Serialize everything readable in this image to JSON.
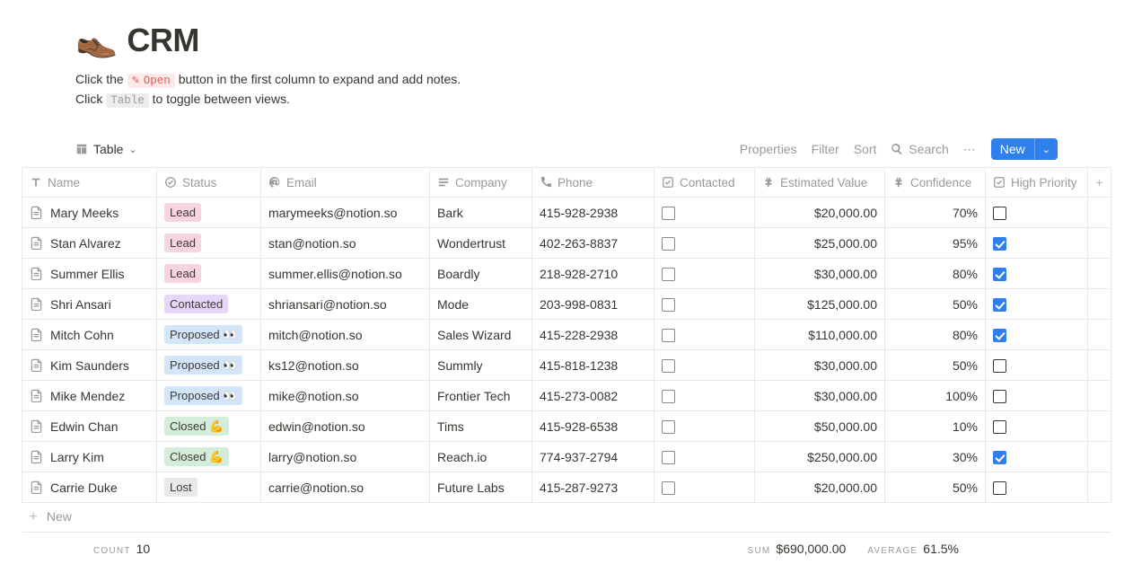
{
  "header": {
    "emoji": "👞",
    "title": "CRM",
    "intro1_pre": "Click the ",
    "intro1_chip": "Open",
    "intro1_post": " button in the first column to expand and add notes.",
    "intro2_pre": "Click ",
    "intro2_chip": "Table",
    "intro2_post": " to toggle between views."
  },
  "toolbar": {
    "view_label": "Table",
    "properties": "Properties",
    "filter": "Filter",
    "sort": "Sort",
    "search": "Search",
    "new_label": "New"
  },
  "columns": {
    "name": "Name",
    "status": "Status",
    "email": "Email",
    "company": "Company",
    "phone": "Phone",
    "contacted": "Contacted",
    "est_value": "Estimated Value",
    "confidence": "Confidence",
    "high_priority": "High Priority"
  },
  "status_colors": {
    "Lead": "pink",
    "Contacted": "purple",
    "Proposed 👀": "blue",
    "Closed 💪": "green",
    "Lost": "gray"
  },
  "rows": [
    {
      "name": "Mary Meeks",
      "status": "Lead",
      "email": "marymeeks@notion.so",
      "company": "Bark",
      "phone": "415-928-2938",
      "contacted": false,
      "est_value": "$20,000.00",
      "confidence": "70%",
      "high_priority": false
    },
    {
      "name": "Stan Alvarez",
      "status": "Lead",
      "email": "stan@notion.so",
      "company": "Wondertrust",
      "phone": "402-263-8837",
      "contacted": false,
      "est_value": "$25,000.00",
      "confidence": "95%",
      "high_priority": true
    },
    {
      "name": "Summer Ellis",
      "status": "Lead",
      "email": "summer.ellis@notion.so",
      "company": "Boardly",
      "phone": "218-928-2710",
      "contacted": false,
      "est_value": "$30,000.00",
      "confidence": "80%",
      "high_priority": true
    },
    {
      "name": "Shri Ansari",
      "status": "Contacted",
      "email": "shriansari@notion.so",
      "company": "Mode",
      "phone": "203-998-0831",
      "contacted": false,
      "est_value": "$125,000.00",
      "confidence": "50%",
      "high_priority": true
    },
    {
      "name": "Mitch Cohn",
      "status": "Proposed 👀",
      "email": "mitch@notion.so",
      "company": "Sales Wizard",
      "phone": "415-228-2938",
      "contacted": false,
      "est_value": "$110,000.00",
      "confidence": "80%",
      "high_priority": true
    },
    {
      "name": "Kim Saunders",
      "status": "Proposed 👀",
      "email": "ks12@notion.so",
      "company": "Summly",
      "phone": "415-818-1238",
      "contacted": false,
      "est_value": "$30,000.00",
      "confidence": "50%",
      "high_priority": false
    },
    {
      "name": "Mike Mendez",
      "status": "Proposed 👀",
      "email": "mike@notion.so",
      "company": "Frontier Tech",
      "phone": "415-273-0082",
      "contacted": false,
      "est_value": "$30,000.00",
      "confidence": "100%",
      "high_priority": false
    },
    {
      "name": "Edwin Chan",
      "status": "Closed 💪",
      "email": "edwin@notion.so",
      "company": "Tims",
      "phone": "415-928-6538",
      "contacted": false,
      "est_value": "$50,000.00",
      "confidence": "10%",
      "high_priority": false
    },
    {
      "name": "Larry Kim",
      "status": "Closed 💪",
      "email": "larry@notion.so",
      "company": "Reach.io",
      "phone": "774-937-2794",
      "contacted": false,
      "est_value": "$250,000.00",
      "confidence": "30%",
      "high_priority": true
    },
    {
      "name": "Carrie Duke",
      "status": "Lost",
      "email": "carrie@notion.so",
      "company": "Future Labs",
      "phone": "415-287-9273",
      "contacted": false,
      "est_value": "$20,000.00",
      "confidence": "50%",
      "high_priority": false
    }
  ],
  "newrow_label": "New",
  "footer": {
    "count_label": "COUNT",
    "count_value": "10",
    "sum_label": "SUM",
    "sum_value": "$690,000.00",
    "avg_label": "AVERAGE",
    "avg_value": "61.5%"
  }
}
